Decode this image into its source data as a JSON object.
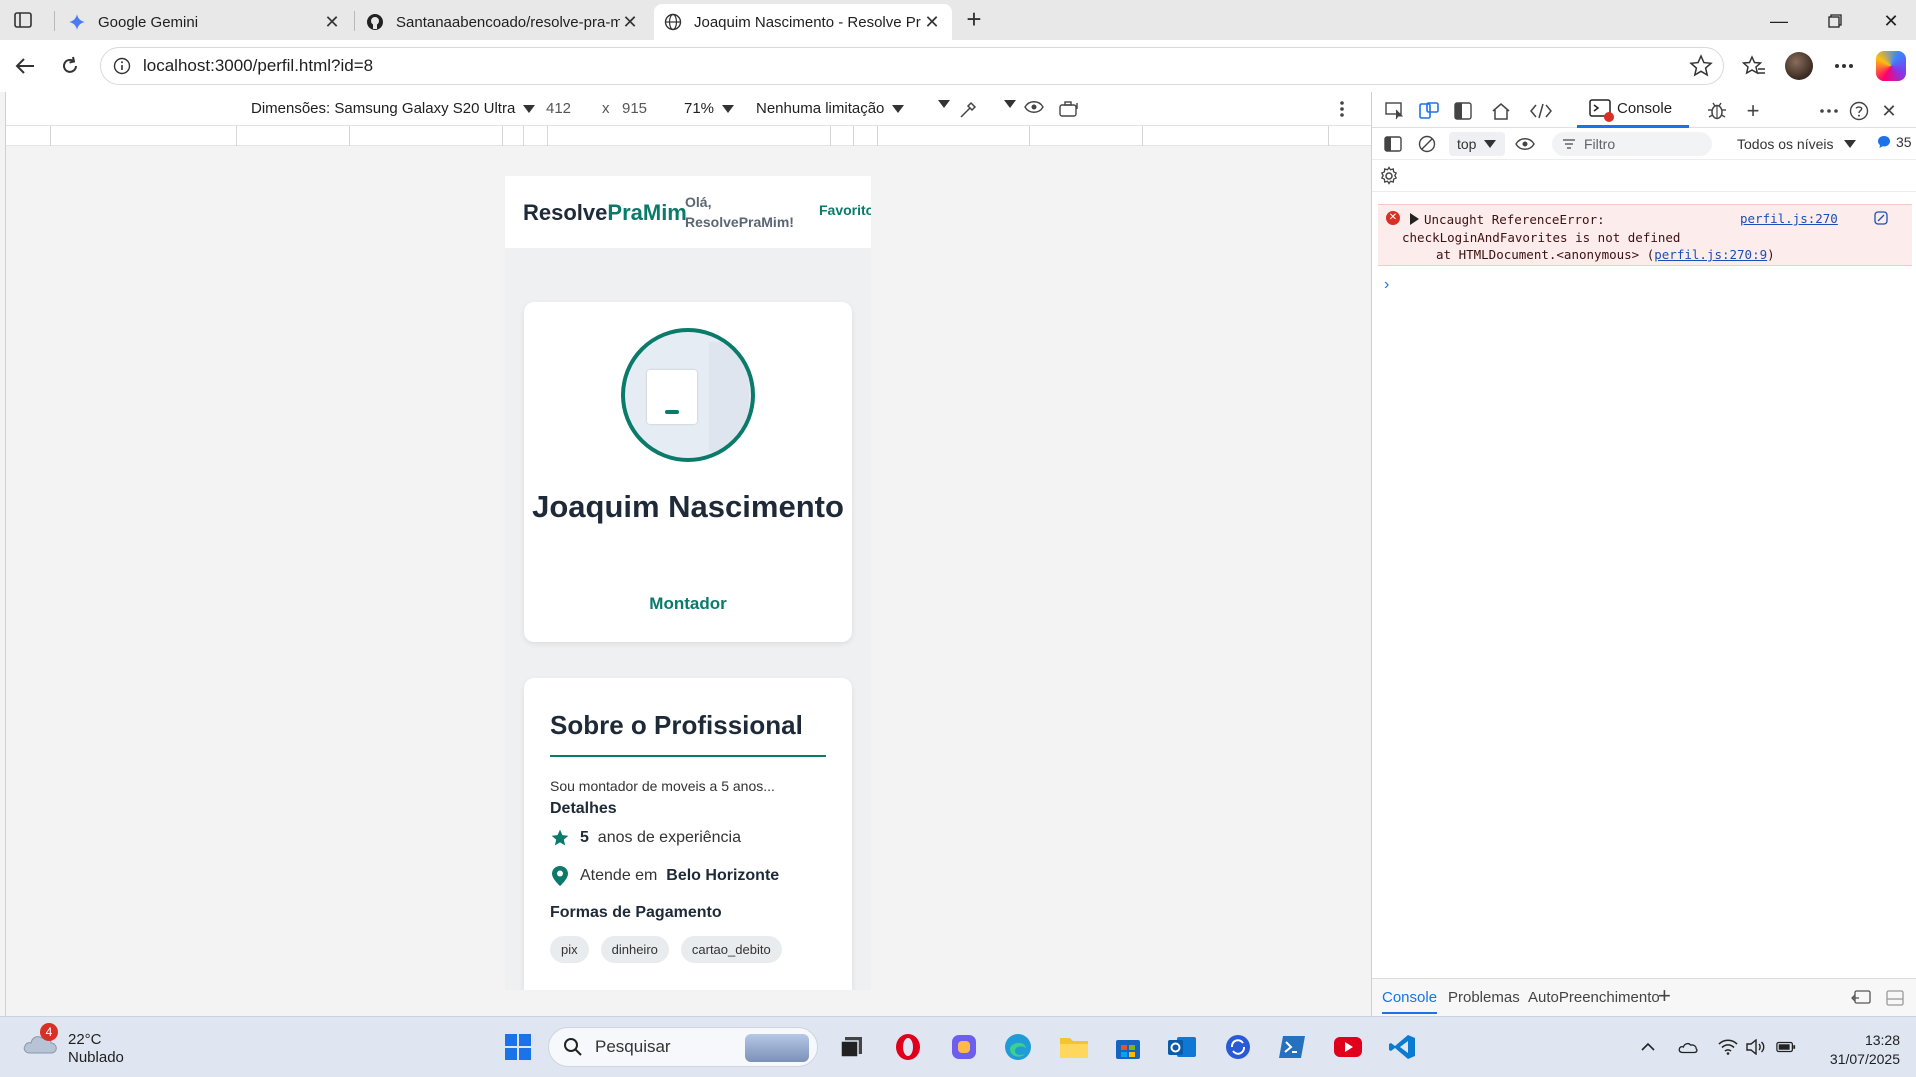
{
  "browser": {
    "tabs": [
      {
        "title": "Google Gemini",
        "active": false
      },
      {
        "title": "Santanaabencoado/resolve-pra-m",
        "active": false
      },
      {
        "title": "Joaquim Nascimento - Resolve Pr",
        "active": true
      }
    ],
    "url": "localhost:3000/perfil.html?id=8"
  },
  "device_toolbar": {
    "dimensions_label": "Dimensões: Samsung Galaxy S20 Ultra",
    "width": "412",
    "times": "x",
    "height": "915",
    "zoom": "71%",
    "throttle": "Nenhuma limitação"
  },
  "page": {
    "brand_main": "Resolve",
    "brand_accent": "PraMim",
    "greeting_line1": "Olá,",
    "greeting_line2": "ResolvePraMim!",
    "favorites_link": "Favorito",
    "profile": {
      "name": "Joaquim Nascimento",
      "role": "Montador"
    },
    "about": {
      "title": "Sobre o Profissional",
      "text": "Sou montador de moveis a 5 anos...",
      "details_title": "Detalhes",
      "experience_value": "5",
      "experience_label": "anos de experiência",
      "location_label": "Atende em",
      "location_value": "Belo Horizonte",
      "payment_title": "Formas de Pagamento",
      "payments": [
        "pix",
        "dinheiro",
        "cartao_debito"
      ]
    }
  },
  "devtools": {
    "console_tab": "Console",
    "context": "top",
    "filter_placeholder": "Filtro",
    "levels": "Todos os níveis",
    "issues_count": "35",
    "error": {
      "line1": "Uncaught ReferenceError:",
      "line2": "checkLoginAndFavorites is not defined",
      "line3_prefix": "at HTMLDocument.<anonymous> (",
      "line3_link": "perfil.js:270:9",
      "line3_suffix": ")",
      "source": "perfil.js:270"
    },
    "drawer_tabs": [
      "Console",
      "Problemas",
      "AutoPreenchimento"
    ]
  },
  "taskbar": {
    "weather_badge": "4",
    "temperature": "22°C",
    "condition": "Nublado",
    "search_placeholder": "Pesquisar",
    "time": "13:28",
    "date": "31/07/2025"
  },
  "colors": {
    "brand_teal": "#0a7a6a",
    "devtools_blue": "#1a73e8",
    "error_red": "#d93025"
  }
}
